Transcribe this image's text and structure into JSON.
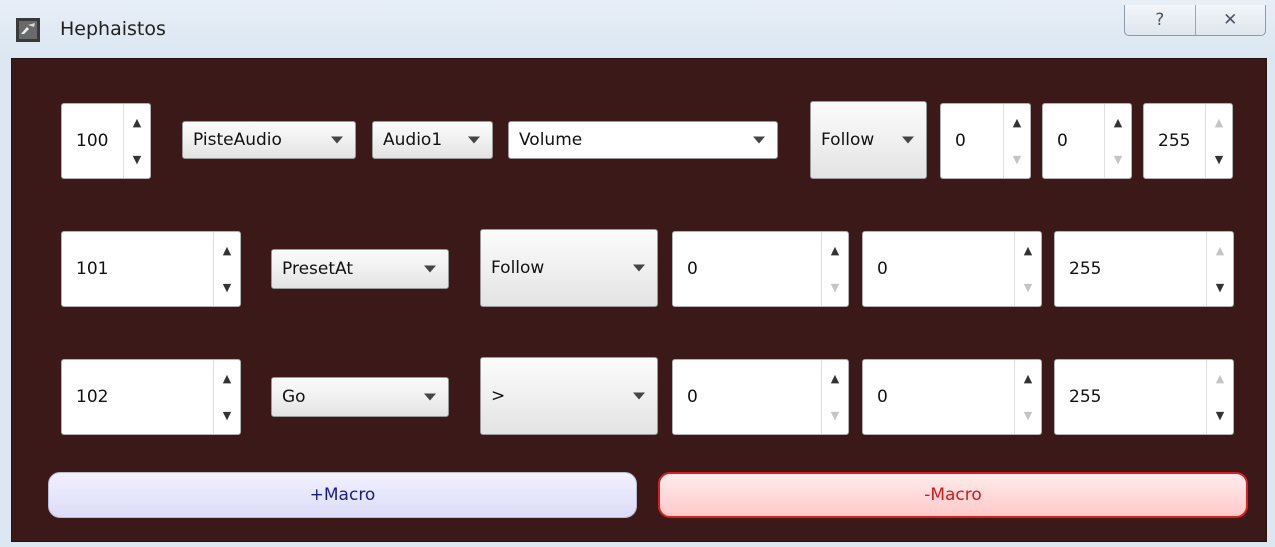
{
  "window": {
    "title": "Hephaistos",
    "controls": {
      "help_glyph": "?",
      "close_glyph": "✕"
    }
  },
  "rows": [
    {
      "index": "100",
      "source": "PisteAudio",
      "target": "Audio1",
      "param": "Volume",
      "mode": "Follow",
      "v1": "0",
      "v2": "0",
      "v3": "255"
    },
    {
      "index": "101",
      "source": "PresetAt",
      "mode": "Follow",
      "v1": "0",
      "v2": "0",
      "v3": "255"
    },
    {
      "index": "102",
      "source": "Go",
      "mode": ">",
      "v1": "0",
      "v2": "0",
      "v3": "255"
    }
  ],
  "buttons": {
    "add_macro": "+Macro",
    "remove_macro": "-Macro"
  },
  "colors": {
    "panel_bg": "#3b1919",
    "add_accent": "#1b1b8a",
    "remove_accent": "#d51818"
  },
  "icons": {
    "app": "anvil-icon",
    "up": "arrow-up-icon",
    "down": "arrow-down-icon",
    "dropdown": "chevron-down-icon"
  }
}
